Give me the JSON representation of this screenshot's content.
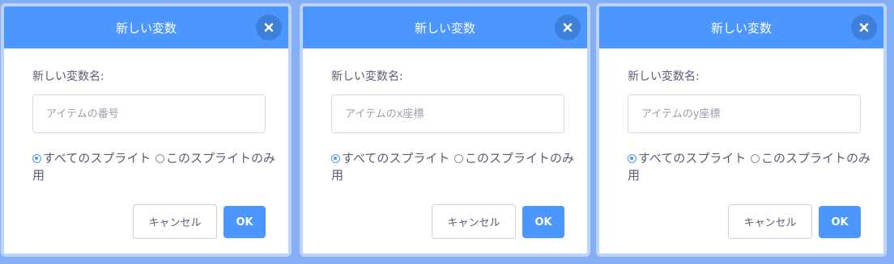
{
  "colors": {
    "accent": "#4c97ff",
    "close_bg": "#3d7fd9",
    "text": "#575e75",
    "backdrop": "#8ab4f8"
  },
  "dialogs": [
    {
      "title": "新しい変数",
      "close_icon": "close-icon",
      "name_label": "新しい変数名:",
      "input_value": "",
      "input_placeholder": "アイテムの番号",
      "radio_all": "すべてのスプライト用",
      "radio_this": "このスプライトのみ",
      "radio_selected": "all",
      "cancel_label": "キャンセル",
      "ok_label": "OK"
    },
    {
      "title": "新しい変数",
      "close_icon": "close-icon",
      "name_label": "新しい変数名:",
      "input_value": "",
      "input_placeholder": "アイテムのx座標",
      "radio_all": "すべてのスプライト用",
      "radio_this": "このスプライトのみ",
      "radio_selected": "all",
      "cancel_label": "キャンセル",
      "ok_label": "OK"
    },
    {
      "title": "新しい変数",
      "close_icon": "close-icon",
      "name_label": "新しい変数名:",
      "input_value": "",
      "input_placeholder": "アイテムのy座標",
      "radio_all": "すべてのスプライト用",
      "radio_this": "このスプライトのみ",
      "radio_selected": "all",
      "cancel_label": "キャンセル",
      "ok_label": "OK"
    }
  ]
}
